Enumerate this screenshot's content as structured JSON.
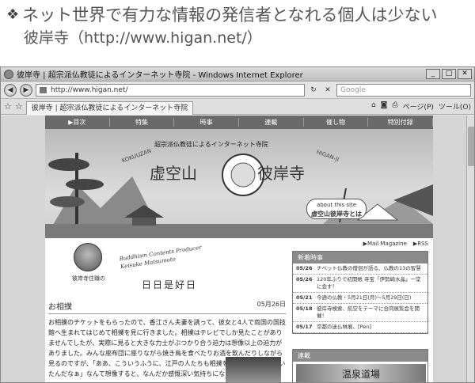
{
  "caption": {
    "bullet": "❖",
    "title": "ネット世界で有力な情報の発信者となれる個人は少ない",
    "site": "彼岸寺（http://www.higan.net/）"
  },
  "browser": {
    "window_title": "彼岸寺 | 超宗派仏教徒によるインターネット寺院 - Windows Internet Explorer",
    "url": "http://www.higan.net/",
    "search_placeholder": "Google",
    "tab_label": "彼岸寺 | 超宗派仏教徒によるインターネット寺院",
    "toolbar": {
      "page": "ページ(P)",
      "tools": "ツール(O)"
    },
    "controls": {
      "back": "◀",
      "forward": "▶",
      "refresh": "↻",
      "stop": "✕",
      "min": "_",
      "max": "□",
      "close": "✕"
    }
  },
  "site": {
    "nav": [
      "▶目次",
      "特集",
      "時事",
      "連載",
      "催し物",
      "特別付録"
    ],
    "banner": {
      "subtitle": "超宗派仏教徒によるインターネット寺院",
      "name_left": "虚空山",
      "name_right": "彼岸寺",
      "en_left": "KOKUUZAN",
      "en_right": "HIGAN-JI",
      "about_en": "about this site",
      "about_ja": "虚空山彼岸寺とは"
    },
    "header_links": {
      "mail": "▶Mail Magazine",
      "rss": "▶RSS"
    },
    "profile": {
      "producer_en": "Buddhism Contents Producer",
      "producer_name": "Keisuke Matsumoto",
      "caption": "彼岸寺住職の",
      "motto": "日日是好日"
    },
    "article": {
      "title": "お相撲",
      "date": "05月26日",
      "body": "お相撲のチケットをもらったので、香江さん夫妻を誘って、彼女と4人で両国の国技館へ生まれてはじめて相撲を見に行きました。相撲はテレビでしか見たことがありませんでしたが、実際に見ると大きな力士がぶつかり合う迫力は想像以上の迫力がありました。みんな座布団に座りながら焼き鳥を食べたりお酒を飲んだりしながら見るのですが、「ああ、こういうふうに、江戸の人たちも相撲を見ながら楽しんでいたんだなぁ」なんて想像すると、なんだか感慨深い気持ちになります。"
    },
    "news": {
      "heading": "新着時事",
      "items": [
        {
          "date": "05/26",
          "text": "チベット仏教の僧侶が語る、仏教の13の智慧"
        },
        {
          "date": "05/26",
          "text": "120年ぶりで初開帳 寺宝「伊勢崎水晶」一堂に会す！"
        },
        {
          "date": "05/21",
          "text": "今週の仏教・5月21日(月)〜5月29日(日)"
        },
        {
          "date": "05/18",
          "text": "彼岸寺検索、航空をテーマに合同展覧会を開催！"
        },
        {
          "date": "05/17",
          "text": "京都の迷仏林展、[Pen]"
        }
      ]
    },
    "serial": {
      "heading": "連載",
      "image_text": "温泉道場"
    }
  }
}
